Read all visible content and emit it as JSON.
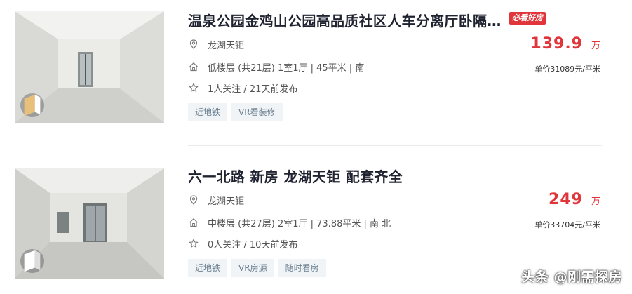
{
  "listings": [
    {
      "title": "温泉公园金鸡山公园高品质社区人车分离厅卧隔断 南北通透",
      "hot_tag": "必看好房",
      "community": "龙湖天钜",
      "house_info": "低楼层 (共21层) 1室1厅 | 45平米 | 南",
      "follow_info": "1人关注 / 21天前发布",
      "tags": [
        "近地铁",
        "VR看装修"
      ],
      "price": "139.9",
      "price_unit": "万",
      "unit_price": "单价31089元/平米"
    },
    {
      "title": "六一北路 新房 龙湖天钜 配套齐全",
      "community": "龙湖天钜",
      "house_info": "中楼层 (共27层) 2室1厅 | 73.88平米 | 南 北",
      "follow_info": "0人关注 / 10天前发布",
      "tags": [
        "近地铁",
        "VR房源",
        "随时看房"
      ],
      "price": "249",
      "price_unit": "万",
      "unit_price": "单价33704元/平米"
    }
  ],
  "watermark": "头条 @刚需探房",
  "icons": {
    "location": "location-pin-icon",
    "house": "house-icon",
    "follow": "star-icon",
    "vr": "vr-badge-icon"
  },
  "colors": {
    "price_red": "#e0363b",
    "tag_bg": "#f0f4f7",
    "title": "#1f2330"
  }
}
